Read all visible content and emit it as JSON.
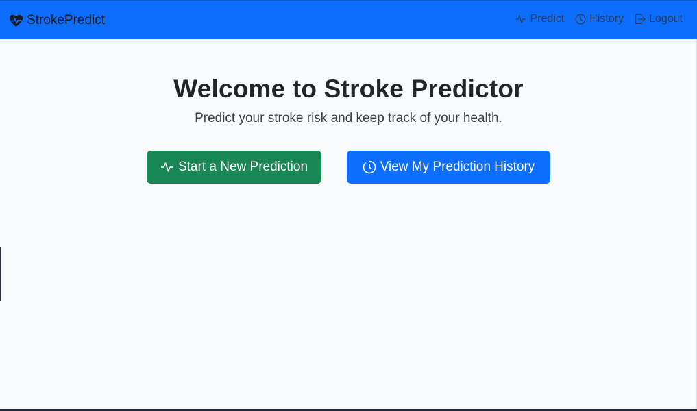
{
  "navbar": {
    "brand": "StrokePredict",
    "links": [
      {
        "label": "Predict",
        "icon": "activity-icon"
      },
      {
        "label": "History",
        "icon": "clock-icon"
      },
      {
        "label": "Logout",
        "icon": "logout-icon"
      }
    ]
  },
  "hero": {
    "title": "Welcome to Stroke Predictor",
    "subtitle": "Predict your stroke risk and keep track of your health."
  },
  "actions": {
    "new_prediction": "Start a New Prediction",
    "history": "View My Prediction History"
  },
  "colors": {
    "navbar": "#0d6efd",
    "success": "#198754",
    "primary": "#0d6efd",
    "background": "#f8f9fa"
  }
}
